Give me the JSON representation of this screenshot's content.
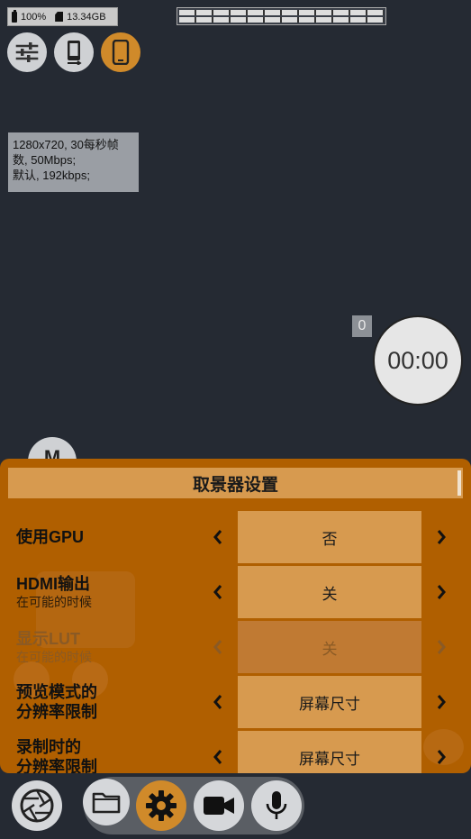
{
  "status": {
    "battery_text": "100%",
    "storage_text": "13.34GB"
  },
  "top_buttons": [
    {
      "icon": "sliders-icon"
    },
    {
      "icon": "phone-rotate-icon"
    },
    {
      "icon": "phone-icon",
      "active": true
    }
  ],
  "info": {
    "line1": "1280x720, 30每秒帧",
    "line2": "数, 50Mbps;",
    "line3": "默认, 192kbps;"
  },
  "counter": "0",
  "timer": "00:00",
  "mode_button": "M",
  "panel": {
    "title": "取景器设置",
    "rows": [
      {
        "label": "使用GPU",
        "sub": "",
        "value": "否",
        "enabled": true
      },
      {
        "label": "HDMI输出",
        "sub": "在可能的时候",
        "value": "关",
        "enabled": true
      },
      {
        "label": "显示LUT",
        "sub": "在可能的时候",
        "value": "关",
        "enabled": false
      },
      {
        "label": "预览模式的",
        "label2": "分辨率限制",
        "value": "屏幕尺寸",
        "enabled": true
      },
      {
        "label": "录制时的",
        "label2": "分辨率限制",
        "value": "屏幕尺寸",
        "enabled": true
      }
    ]
  },
  "bottom": {
    "buttons": [
      "shutter-icon",
      "folder-icon",
      "gear-icon",
      "video-camera-icon",
      "microphone-icon"
    ],
    "active": "gear-icon"
  },
  "colors": {
    "background": "#252a33",
    "panel": "#b05f00",
    "accent": "#d08a2a",
    "cell": "#d79a4f"
  }
}
